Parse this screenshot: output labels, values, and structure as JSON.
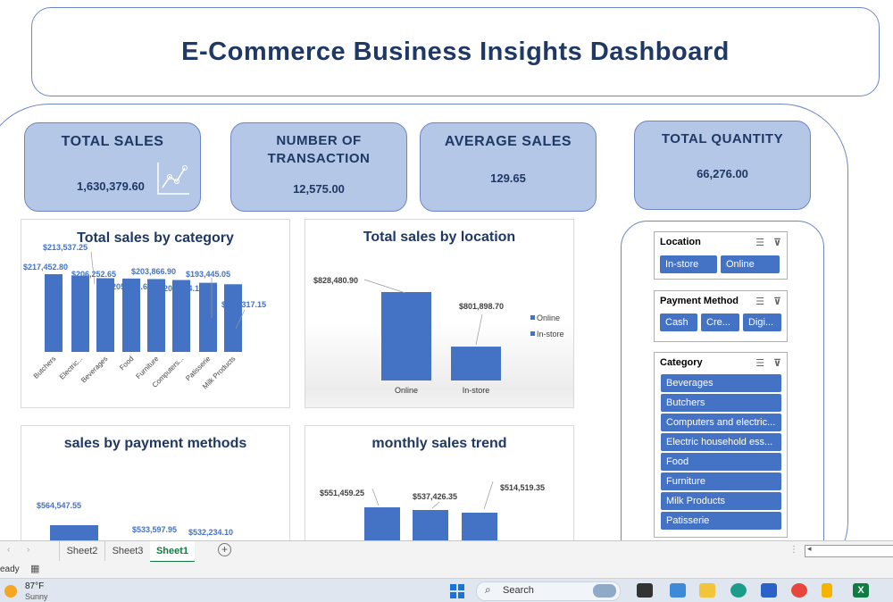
{
  "title": "E-Commerce Business Insights Dashboard",
  "kpis": {
    "total_sales": {
      "label": "TOTAL SALES",
      "value": "1,630,379.60"
    },
    "transactions": {
      "label_line1": "NUMBER OF",
      "label_line2": "TRANSACTION",
      "value": "12,575.00"
    },
    "average_sales": {
      "label": "AVERAGE SALES",
      "value": "129.65"
    },
    "total_quantity": {
      "label": "TOTAL QUANTITY",
      "value": "66,276.00"
    }
  },
  "charts": {
    "category": {
      "title": "Total sales by category"
    },
    "location": {
      "title": "Total sales by location"
    },
    "payment": {
      "title": "sales by payment methods"
    },
    "monthly": {
      "title": "monthly sales trend"
    }
  },
  "chart_data": [
    {
      "type": "bar",
      "title": "Total sales by category",
      "categories": [
        "Butchers",
        "Electric...",
        "Beverages",
        "Food",
        "Furniture",
        "Computers...",
        "Patisserie",
        "Milk Products"
      ],
      "values": [
        217452.8,
        213537.25,
        206252.65,
        205313.65,
        203866.9,
        201194.15,
        193445.05,
        189317.15
      ],
      "data_labels": [
        "$217,452.80",
        "$213,537.25",
        "$206,252.65",
        "$205,313.65",
        "$203,866.90",
        "$201,194.15",
        "$193,445.05",
        "$189,317.15"
      ],
      "color": "#4472c4"
    },
    {
      "type": "bar",
      "title": "Total sales by location",
      "categories": [
        "Online",
        "In-store"
      ],
      "values": [
        828480.9,
        801898.7
      ],
      "data_labels": [
        "$828,480.90",
        "$801,898.70"
      ],
      "legend": [
        "Online",
        "In-store"
      ],
      "legend_position": "right",
      "color": "#4472c4"
    },
    {
      "type": "bar",
      "title": "sales by payment methods",
      "values": [
        564547.55,
        533597.95,
        532234.1
      ],
      "data_labels": [
        "$564,547.55",
        "$533,597.95",
        "$532,234.10"
      ],
      "color": "#4472c4"
    },
    {
      "type": "bar",
      "title": "monthly sales trend",
      "values": [
        551459.25,
        537426.35,
        514519.35
      ],
      "data_labels": [
        "$551,459.25",
        "$537,426.35",
        "$514,519.35"
      ],
      "color": "#4472c4"
    }
  ],
  "slicers": {
    "location": {
      "title": "Location",
      "items": [
        "In-store",
        "Online"
      ]
    },
    "payment": {
      "title": "Payment Method",
      "items": [
        "Cash",
        "Cre...",
        "Digi..."
      ]
    },
    "category": {
      "title": "Category",
      "items": [
        "Beverages",
        "Butchers",
        "Computers and electric...",
        "Electric household ess...",
        "Food",
        "Furniture",
        "Milk Products",
        "Patisserie"
      ]
    }
  },
  "sheets": [
    "Sheet2",
    "Sheet3",
    "Sheet1"
  ],
  "active_sheet": "Sheet1",
  "status": {
    "text": "eady"
  },
  "taskbar": {
    "weather_temp": "87°F",
    "weather_desc": "Sunny",
    "search_placeholder": "Search"
  },
  "colors": {
    "accent": "#4472c4",
    "kpi_fill": "#b4c7e7",
    "title_text": "#1f3864",
    "value_label": "#4472c4"
  }
}
